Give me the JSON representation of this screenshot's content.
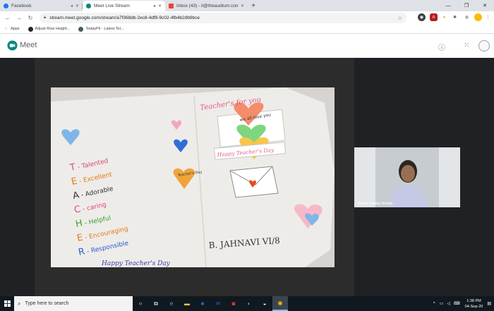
{
  "browser": {
    "tabs": [
      {
        "label": "Facebook",
        "favicon_color": "#1877f2",
        "active": false
      },
      {
        "label": "Meet Live Stream",
        "favicon_color": "#00897b",
        "active": true
      },
      {
        "label": "Inbox (43) - it@theaudium.com",
        "favicon_color": "#ea4335",
        "active": false
      }
    ],
    "new_tab_icon": "+",
    "url": "stream.meet.google.com/stream/a7f368db-2ec8-4df9-9c02-4fb4b2db9bce",
    "bookmarks": [
      {
        "label": "Apps",
        "icon": "apps-grid-icon"
      },
      {
        "label": "Adjust Row Height...",
        "icon": "github-icon"
      },
      {
        "label": "TodayPk - Latest Tel...",
        "icon": "todaypk-icon"
      }
    ]
  },
  "meet": {
    "title": "Meet",
    "presenter_name": "Veena Chaitu Reddy",
    "card": {
      "header": "Teacher's for you",
      "acrostic": [
        {
          "letter": "T",
          "word": "- Talented",
          "color": "#d84a7a"
        },
        {
          "letter": "E",
          "word": "- Excellent",
          "color": "#e07a1c"
        },
        {
          "letter": "A",
          "word": "- Adorable",
          "color": "#333333"
        },
        {
          "letter": "C",
          "word": "- caring",
          "color": "#e0457b"
        },
        {
          "letter": "H",
          "word": "- Helpful",
          "color": "#3b9d3b"
        },
        {
          "letter": "E",
          "word": "- Encouraging",
          "color": "#e07a1c"
        },
        {
          "letter": "R",
          "word": "- Responsible",
          "color": "#2a5bd7"
        }
      ],
      "heart_note_1": "we all love you",
      "heart_note_2": "Teacher's Day",
      "banner": "Happy Teacher's Day",
      "footer_left": "Happy Teacher's Day",
      "signature": "B. JAHNAVI VI/8"
    }
  },
  "taskbar": {
    "search_placeholder": "Type here to search",
    "time": "1:38 PM",
    "date": "04-Sep-20"
  }
}
